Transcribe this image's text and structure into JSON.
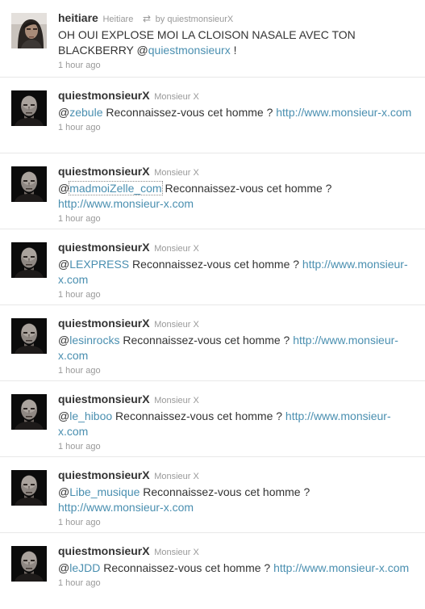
{
  "tweets": [
    {
      "screen_name": "heitiare",
      "full_name": "Heitiare",
      "retweet_icon": "retweet-icon",
      "retweeted_by": "by quiestmonsieurX",
      "text_before": "OH OUI EXPLOSE MOI LA CLOISON NASALE AVEC TON BLACKBERRY ",
      "mention_at": "@",
      "mention": "quiestmonsieurx",
      "text_after": " !",
      "time": "1 hour ago",
      "avatar": "heitiare-avatar"
    },
    {
      "screen_name": "quiestmonsieurX",
      "full_name": "Monsieur X",
      "mention_at": "@",
      "mention": "zebule",
      "body": " Reconnaissez-vous cet homme ? ",
      "link": "http://www.monsieur-x.com",
      "time": "1 hour ago",
      "avatar": "monsieur-x-avatar"
    },
    {
      "screen_name": "quiestmonsieurX",
      "full_name": "Monsieur X",
      "mention_at": "@",
      "mention": "madmoiZelle_com",
      "body": " Reconnaissez-vous cet homme ? ",
      "link": "http://www.monsieur-x.com",
      "time": "1 hour ago",
      "avatar": "monsieur-x-avatar"
    },
    {
      "screen_name": "quiestmonsieurX",
      "full_name": "Monsieur X",
      "mention_at": "@",
      "mention": "LEXPRESS",
      "body": " Reconnaissez-vous cet homme ? ",
      "link": "http://www.monsieur-x.com",
      "time": "1 hour ago",
      "avatar": "monsieur-x-avatar"
    },
    {
      "screen_name": "quiestmonsieurX",
      "full_name": "Monsieur X",
      "mention_at": "@",
      "mention": "lesinrocks",
      "body": " Reconnaissez-vous cet homme ? ",
      "link": "http://www.monsieur-x.com",
      "time": "1 hour ago",
      "avatar": "monsieur-x-avatar"
    },
    {
      "screen_name": "quiestmonsieurX",
      "full_name": "Monsieur X",
      "mention_at": "@",
      "mention": "le_hiboo",
      "body": " Reconnaissez-vous cet homme ? ",
      "link": "http://www.monsieur-x.com",
      "time": "1 hour ago",
      "avatar": "monsieur-x-avatar"
    },
    {
      "screen_name": "quiestmonsieurX",
      "full_name": "Monsieur X",
      "mention_at": "@",
      "mention": "Libe_musique",
      "body": " Reconnaissez-vous cet homme ? ",
      "link": "http://www.monsieur-x.com",
      "time": "1 hour ago",
      "avatar": "monsieur-x-avatar"
    },
    {
      "screen_name": "quiestmonsieurX",
      "full_name": "Monsieur X",
      "mention_at": "@",
      "mention": "leJDD",
      "body": " Reconnaissez-vous cet homme ? ",
      "link": "http://www.monsieur-x.com",
      "time": "1 hour ago",
      "avatar": "monsieur-x-avatar"
    }
  ],
  "colors": {
    "link": "#4a8fb0",
    "text": "#333333",
    "meta": "#999999",
    "divider": "#e8e8e8"
  }
}
